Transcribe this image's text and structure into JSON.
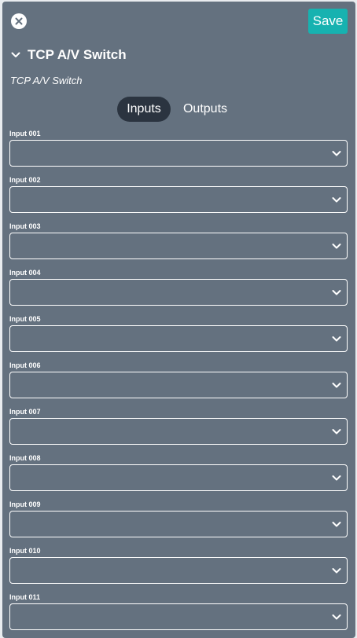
{
  "toolbar": {
    "close_icon": "close-circle-icon",
    "save_label": "Save"
  },
  "colors": {
    "panel_bg": "#64717f",
    "accent": "#17b2b0",
    "tab_active_bg": "#2b3440"
  },
  "device": {
    "title": "TCP A/V Switch",
    "subtitle": "TCP A/V Switch",
    "expanded": true
  },
  "tabs": [
    {
      "label": "Inputs",
      "active": true
    },
    {
      "label": "Outputs",
      "active": false
    }
  ],
  "inputs": [
    {
      "label": "Input 001",
      "value": ""
    },
    {
      "label": "Input 002",
      "value": ""
    },
    {
      "label": "Input 003",
      "value": ""
    },
    {
      "label": "Input 004",
      "value": ""
    },
    {
      "label": "Input 005",
      "value": ""
    },
    {
      "label": "Input 006",
      "value": ""
    },
    {
      "label": "Input 007",
      "value": ""
    },
    {
      "label": "Input 008",
      "value": ""
    },
    {
      "label": "Input 009",
      "value": ""
    },
    {
      "label": "Input 010",
      "value": ""
    },
    {
      "label": "Input 011",
      "value": ""
    }
  ]
}
